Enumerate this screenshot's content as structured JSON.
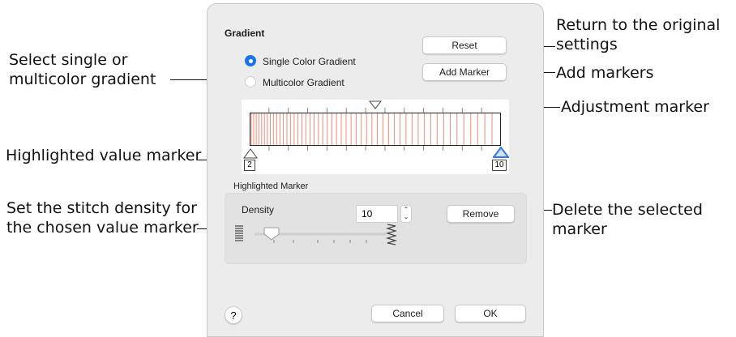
{
  "callouts": {
    "select_gradient": [
      "Select single or",
      "multicolor gradient"
    ],
    "highlighted_value_marker": "Highlighted value marker",
    "set_density": [
      "Set the stitch density for",
      "the chosen value marker"
    ],
    "return_original": [
      "Return to the original",
      "settings"
    ],
    "add_markers": "Add markers",
    "adjustment_marker": "Adjustment marker",
    "delete_selected": [
      "Delete the selected",
      "marker"
    ]
  },
  "dialog": {
    "title": "Gradient",
    "reset_label": "Reset",
    "add_marker_label": "Add Marker",
    "options": [
      {
        "label": "Single Color Gradient",
        "selected": true
      },
      {
        "label": "Multicolor Gradient",
        "selected": false
      }
    ],
    "gradient": {
      "left_marker_value": "2",
      "right_marker_value": "10",
      "line_color": "#f08a7a",
      "marker_highlight_color": "#3a78d8"
    },
    "highlighted_marker": {
      "section_label": "Highlighted Marker",
      "density_label": "Density",
      "density_value": "10",
      "remove_label": "Remove"
    },
    "help_label": "?",
    "cancel_label": "Cancel",
    "ok_label": "OK"
  }
}
